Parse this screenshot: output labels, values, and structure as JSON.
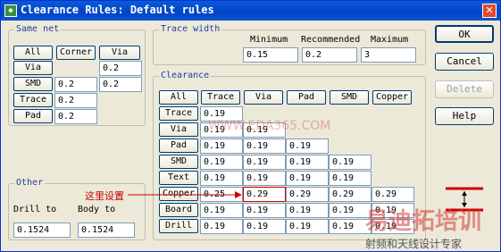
{
  "window": {
    "title": "Clearance Rules: Default rules"
  },
  "same_net": {
    "label": "Same net",
    "buttons": [
      "All",
      "Corner",
      "Via"
    ],
    "via_value": "0.2",
    "rows": [
      {
        "label": "Via",
        "values": [
          "0.2"
        ]
      },
      {
        "label": "SMD",
        "values": [
          "0.2",
          "0.2"
        ]
      },
      {
        "label": "Trace",
        "values": [
          "0.2"
        ]
      },
      {
        "label": "Pad",
        "values": [
          "0.2"
        ]
      }
    ]
  },
  "trace_width": {
    "label": "Trace width",
    "minimum_label": "Minimum",
    "recommended_label": "Recommended",
    "maximum_label": "Maximum",
    "minimum": "0.15",
    "recommended": "0.2",
    "maximum": "3"
  },
  "clearance": {
    "label": "Clearance",
    "columns": [
      "All",
      "Trace",
      "Via",
      "Pad",
      "SMD",
      "Copper"
    ],
    "rows": [
      {
        "label": "Trace",
        "values": [
          "0.19"
        ]
      },
      {
        "label": "Via",
        "values": [
          "0.19",
          "0.19"
        ]
      },
      {
        "label": "Pad",
        "values": [
          "0.19",
          "0.19",
          "0.19"
        ]
      },
      {
        "label": "SMD",
        "values": [
          "0.19",
          "0.19",
          "0.19",
          "0.19"
        ]
      },
      {
        "label": "Text",
        "values": [
          "0.19",
          "0.19",
          "0.19",
          "0.19"
        ]
      },
      {
        "label": "Copper",
        "values": [
          "0.25",
          "0.29",
          "0.29",
          "0.29",
          "0.29"
        ]
      },
      {
        "label": "Board",
        "values": [
          "0.19",
          "0.19",
          "0.19",
          "0.19",
          "0.19"
        ]
      },
      {
        "label": "Drill",
        "values": [
          "0.19",
          "0.19",
          "0.19",
          "0.19",
          "0.19"
        ]
      }
    ]
  },
  "other": {
    "label": "Other",
    "drill_to_label": "Drill to",
    "body_to_label": "Body to",
    "drill_to": "0.1524",
    "body_to": "0.1524"
  },
  "dialog_buttons": {
    "ok": "OK",
    "cancel": "Cancel",
    "delete": "Delete",
    "help": "Help"
  },
  "annotation": {
    "text": "这里设置"
  },
  "watermarks": {
    "url": "WWW.EDA365.COM",
    "brand": "易迪拓培训",
    "slogan": "射频和天线设计专家"
  },
  "colors": {
    "title_bar": "#0a4fd1",
    "group_label": "#1f3f9f",
    "annotation": "#cc0000",
    "highlight": "#cc0000"
  }
}
